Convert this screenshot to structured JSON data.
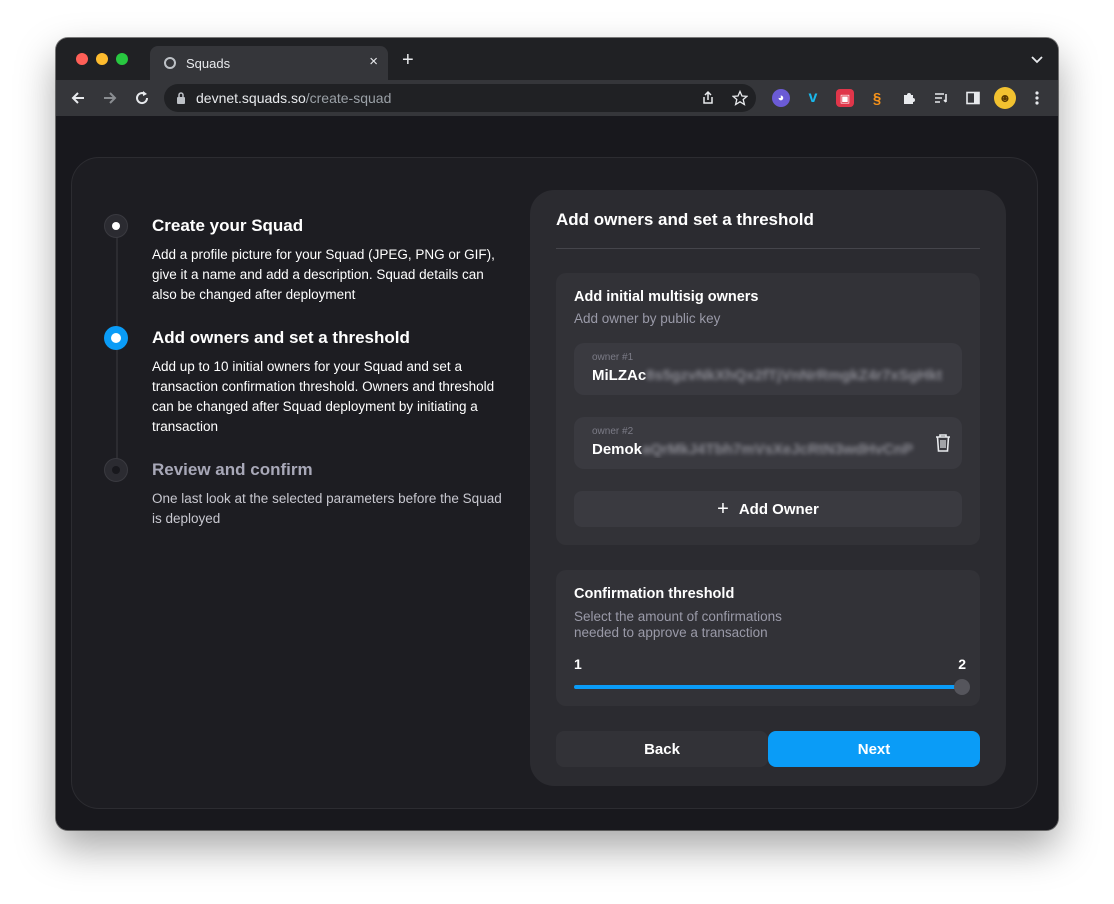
{
  "browser": {
    "tab_title": "Squads",
    "tab_close": "×",
    "new_tab": "+",
    "url_host": "devnet.squads.so",
    "url_path": "/create-squad"
  },
  "steps": [
    {
      "title": "Create your Squad",
      "description": "Add a profile picture for your Squad (JPEG, PNG or GIF), give it a name and add a description. Squad details can also be changed after deployment",
      "state": "done"
    },
    {
      "title": "Add owners and set a threshold",
      "description": "Add up to 10 initial owners for your Squad and set a transaction confirmation threshold. Owners and threshold can be changed after Squad deployment by initiating a transaction",
      "state": "active"
    },
    {
      "title": "Review and confirm",
      "description": "One last look at the selected parameters before the Squad is deployed",
      "state": "todo"
    }
  ],
  "panel": {
    "title": "Add owners and set a threshold",
    "owners_section": {
      "title": "Add initial multisig owners",
      "subtitle": "Add owner by public key",
      "owners": [
        {
          "label": "owner #1",
          "value_visible": "MiLZAc",
          "value_obscured": "8s5gzvNkXhQx2fTjVnNrRmgkZ4r7xSgHkt"
        },
        {
          "label": "owner #2",
          "value_visible": "Demok",
          "value_obscured": "aQrMkJ4Tbh7mVsXeJcRtN3wdHvCnP"
        }
      ],
      "add_owner_label": "Add Owner"
    },
    "threshold_section": {
      "title": "Confirmation threshold",
      "subtitle_line1": "Select the amount of confirmations",
      "subtitle_line2": "needed to approve a transaction",
      "min_label": "1",
      "max_label": "2",
      "value": 2
    },
    "back_label": "Back",
    "next_label": "Next"
  },
  "colors": {
    "accent": "#0a9cf7",
    "background": "#18181d",
    "panel": "#2b2b30"
  }
}
